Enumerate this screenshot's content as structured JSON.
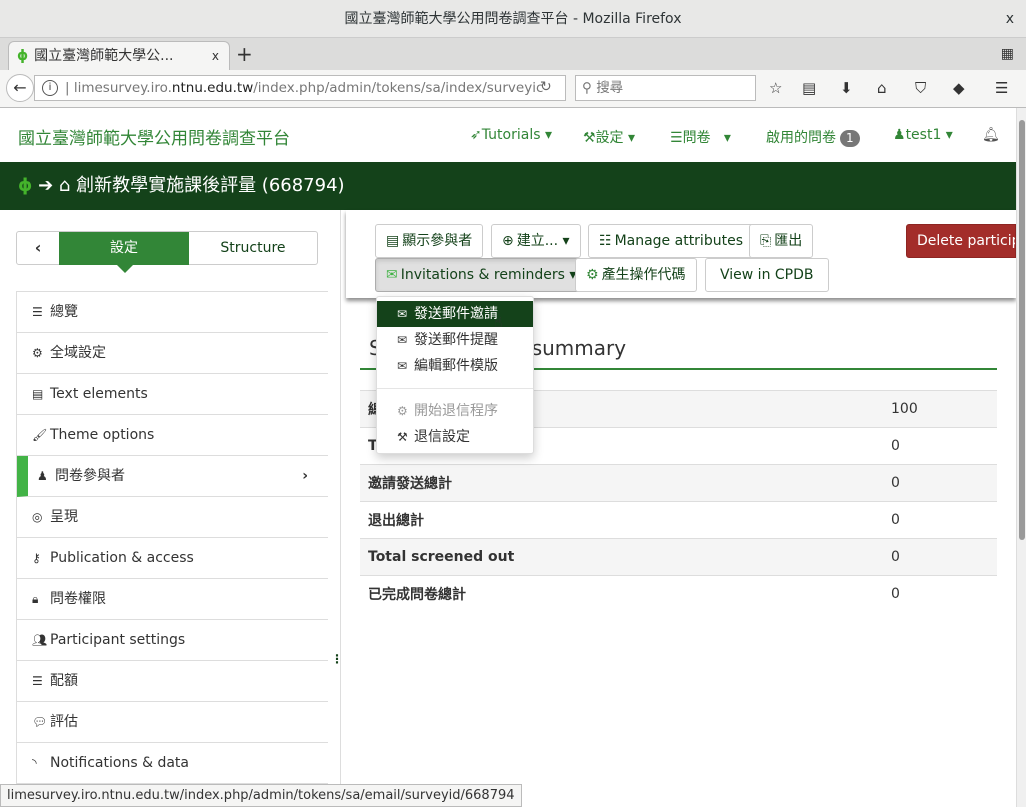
{
  "window": {
    "title": "國立臺灣師範大學公用問卷調查平台 - Mozilla Firefox",
    "close": "x"
  },
  "tab": {
    "title": "國立臺灣師範大學公...",
    "close": "x",
    "new": "+"
  },
  "urlbar": {
    "host_pre": "limesurvey.iro.",
    "host_main": "ntnu.edu.tw",
    "path": "/index.php/admin/tokens/sa/index/surveyic",
    "search_placeholder": "搜尋"
  },
  "site": {
    "name": "國立臺灣師範大學公用問卷調查平台",
    "nav": {
      "tutorials": "Tutorials",
      "settings": "設定",
      "surveys": "問卷",
      "active_surveys": "啟用的問卷",
      "active_count": "1",
      "user": "test1"
    }
  },
  "survey": {
    "title": "創新教學實施課後評量 (668794)"
  },
  "sidebar": {
    "settings_tab": "設定",
    "structure_tab": "Structure",
    "items": [
      {
        "label": "總覽",
        "icon": "list-icon"
      },
      {
        "label": "全域設定",
        "icon": "cogs-icon"
      },
      {
        "label": "Text elements",
        "icon": "file-text-icon"
      },
      {
        "label": "Theme options",
        "icon": "paint-brush-icon"
      },
      {
        "label": "問卷參與者",
        "icon": "user-icon"
      },
      {
        "label": "呈現",
        "icon": "eye-slash-icon"
      },
      {
        "label": "Publication & access",
        "icon": "key-icon"
      },
      {
        "label": "問卷權限",
        "icon": "lock-icon"
      },
      {
        "label": "Participant settings",
        "icon": "users-icon"
      },
      {
        "label": "配額",
        "icon": "tasks-icon"
      },
      {
        "label": "評估",
        "icon": "comment-icon"
      },
      {
        "label": "Notifications & data",
        "icon": "rss-icon"
      }
    ]
  },
  "toolbar": {
    "display": "顯示參與者",
    "create": "建立...",
    "manage_attributes": "Manage attributes",
    "export": "匯出",
    "delete": "Delete participa",
    "invitations": "Invitations & reminders",
    "generate_tokens": "產生操作代碼",
    "view_cpdb": "View in CPDB"
  },
  "dropdown": {
    "send_invitations": "發送郵件邀請",
    "send_reminders": "發送郵件提醒",
    "edit_templates": "編輯郵件模版",
    "start_bounce": "開始退信程序",
    "bounce_settings": "退信設定"
  },
  "summary": {
    "title_start": "S",
    "title_end": "summary",
    "rows": [
      {
        "label": "總",
        "value": "100"
      },
      {
        "label": "T",
        "value": "0"
      },
      {
        "label": "邀請發送總計",
        "value": "0"
      },
      {
        "label": "退出總計",
        "value": "0"
      },
      {
        "label": "Total screened out",
        "value": "0"
      },
      {
        "label": "已完成問卷總計",
        "value": "0"
      }
    ]
  },
  "status": {
    "url": "limesurvey.iro.ntnu.edu.tw/index.php/admin/tokens/sa/email/surveyid/668794"
  },
  "colors": {
    "brand_green": "#328637",
    "dark_green": "#14421a",
    "danger": "#a32d2a",
    "active_marker": "#42b346"
  }
}
